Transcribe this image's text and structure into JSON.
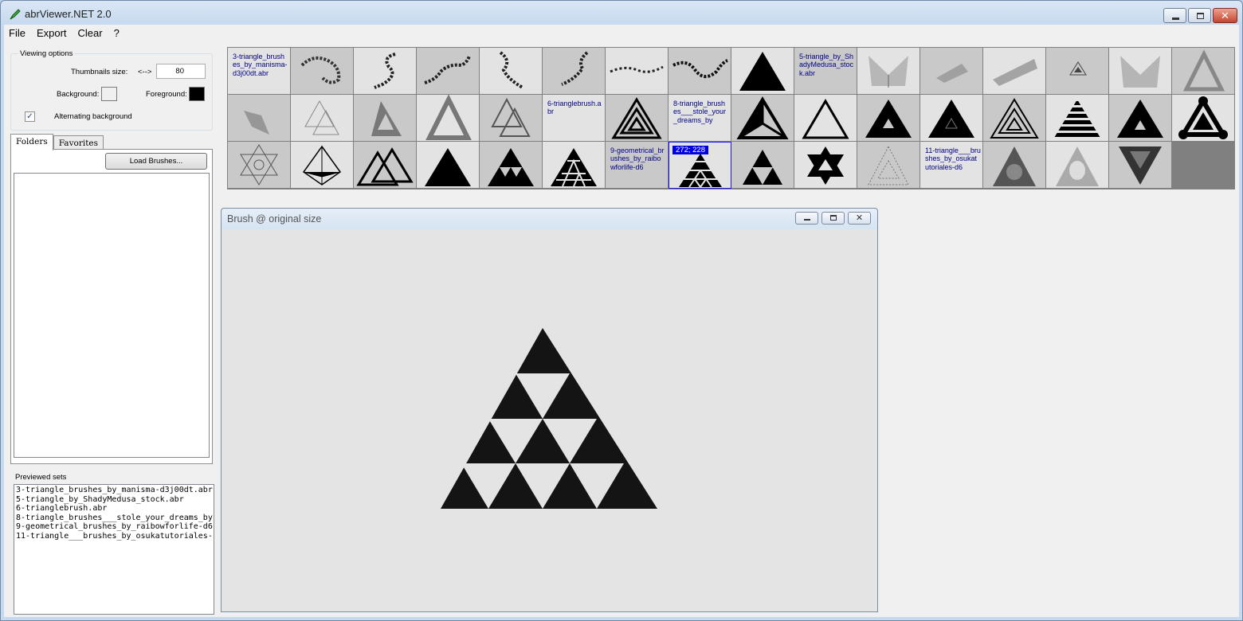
{
  "app": {
    "title": "abrViewer.NET 2.0"
  },
  "menu": [
    "File",
    "Export",
    "Clear",
    "?"
  ],
  "viewing": {
    "caption": "Viewing options",
    "thumb_label": "Thumbnails size:",
    "thumb_arrow": "<-->",
    "thumb_value": "80",
    "background_label": "Background:",
    "foreground_label": "Foreground:",
    "alternating_label": "Alternating background",
    "alternating_checked": "✓",
    "colors": {
      "background": "#f0f0f0",
      "foreground": "#000000"
    }
  },
  "tabs": {
    "folders": "Folders",
    "favorites": "Favorites"
  },
  "load_button": "Load Brushes...",
  "previewed": {
    "caption": "Previewed sets",
    "items": [
      "3-triangle_brushes_by_manisma-d3j00dt.abr",
      "5-triangle_by_ShadyMedusa_stock.abr",
      "6-trianglebrush.abr",
      "8-triangle_brushes___stole_your_dreams_by",
      "9-geometrical_brushes_by_raibowforlife-d6",
      "11-triangle___brushes_by_osukatutoriales-"
    ]
  },
  "thumbnails": {
    "selected_coords": "272; 228",
    "set_labels": {
      "r0c0": "3-triangle_brushes_by_manisma-d3j00dt.abr",
      "r0c10": "5-triangle_by_ShadyMedusa_stock.abr",
      "r1c6": "6-trianglebrush.abr",
      "r1c8": "8-triangle_brushes___stole_your_dreams_by",
      "r2c7": "9-geometrical_brushes_by_raibowforlife-d6",
      "r2c12": "11-triangle___brushes_by_osukatutoriales-d6"
    }
  },
  "brush_window": {
    "title": "Brush @ original size"
  }
}
